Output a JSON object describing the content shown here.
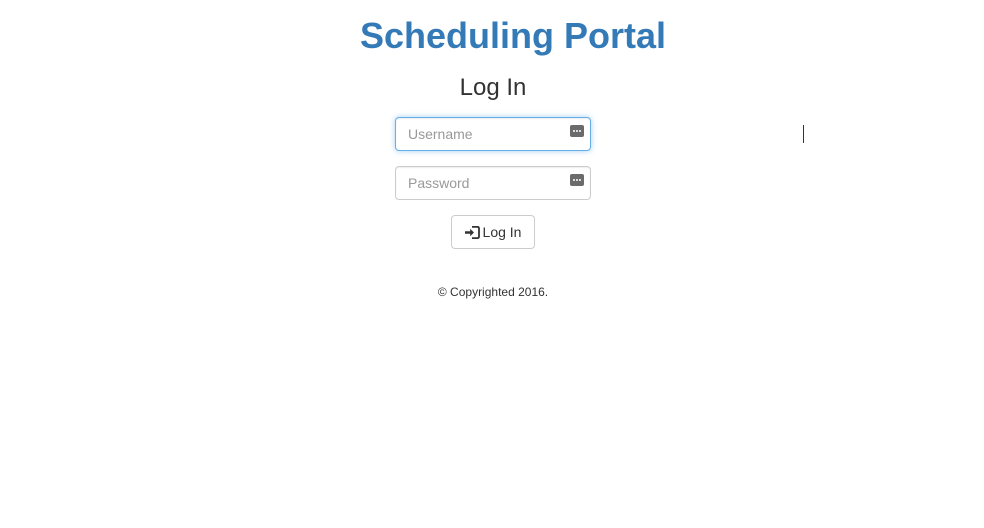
{
  "app": {
    "title": "Scheduling Portal",
    "accent_color": "#337ab7"
  },
  "login_form": {
    "heading": "Log In",
    "username": {
      "placeholder": "Username",
      "value": "",
      "focused": true,
      "icon": "password-manager-key-icon"
    },
    "password": {
      "placeholder": "Password",
      "value": "",
      "icon": "password-manager-key-icon"
    },
    "submit": {
      "label": "Log In",
      "icon": "log-in-icon"
    }
  },
  "footer": {
    "text": "© Copyrighted 2016."
  }
}
